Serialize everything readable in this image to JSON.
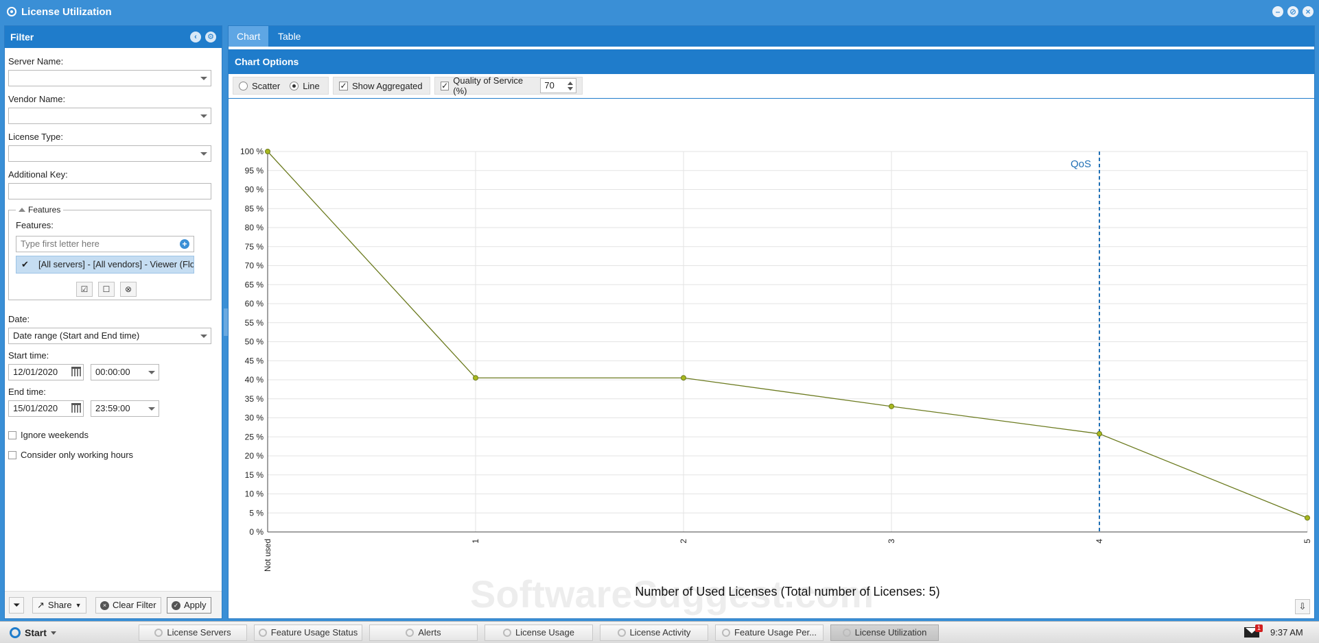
{
  "window": {
    "title": "License Utilization",
    "controls": [
      "minimize",
      "restore",
      "close"
    ]
  },
  "filter": {
    "header": "Filter",
    "server_name_label": "Server Name:",
    "vendor_name_label": "Vendor Name:",
    "license_type_label": "License Type:",
    "additional_key_label": "Additional Key:",
    "features_legend": "Features",
    "features_label": "Features:",
    "features_placeholder": "Type first letter here",
    "feature_item": "[All servers] - [All vendors] - Viewer (Flo",
    "date_label": "Date:",
    "date_value": "Date range (Start and End time)",
    "start_time_label": "Start time:",
    "start_date": "12/01/2020",
    "start_clock": "00:00:00",
    "end_time_label": "End time:",
    "end_date": "15/01/2020",
    "end_clock": "23:59:00",
    "ignore_weekends": "Ignore weekends",
    "working_hours": "Consider only working hours",
    "share_label": "Share",
    "clear_label": "Clear Filter",
    "apply_label": "Apply"
  },
  "tabs": {
    "chart": "Chart",
    "table": "Table"
  },
  "chart_options": {
    "header": "Chart Options",
    "scatter_label": "Scatter",
    "line_label": "Line",
    "selected_mode": "line",
    "show_aggregated_label": "Show Aggregated",
    "qos_label": "Quality of Service (%)",
    "qos_value": "70"
  },
  "chart_data": {
    "type": "line",
    "categories": [
      "Not used",
      "1",
      "2",
      "3",
      "4",
      "5"
    ],
    "values": [
      100,
      40.5,
      40.5,
      33,
      25.8,
      3.7
    ],
    "xlabel": "Number of Used Licenses (Total number of Licenses: 5)",
    "ylabel": "",
    "ylim": [
      0,
      100
    ],
    "y_ticks": [
      "0 %",
      "5 %",
      "10 %",
      "15 %",
      "20 %",
      "25 %",
      "30 %",
      "35 %",
      "40 %",
      "45 %",
      "50 %",
      "55 %",
      "60 %",
      "65 %",
      "70 %",
      "75 %",
      "80 %",
      "85 %",
      "90 %",
      "95 %",
      "100 %"
    ],
    "grid": true,
    "line_color": "#6b7a1e",
    "marker_color": "#a8b81e",
    "qos_marker": {
      "category": "4",
      "label": "QoS",
      "color": "#1f6fb5"
    }
  },
  "watermark": "SoftwareSuggest.com",
  "taskbar": {
    "start_label": "Start",
    "items": [
      "License Servers",
      "Feature Usage Status",
      "Alerts",
      "License Usage",
      "License Activity",
      "Feature Usage Per...",
      "License Utilization"
    ],
    "active_item": "License Utilization",
    "mail_badge": "1",
    "clock": "9:37 AM"
  }
}
